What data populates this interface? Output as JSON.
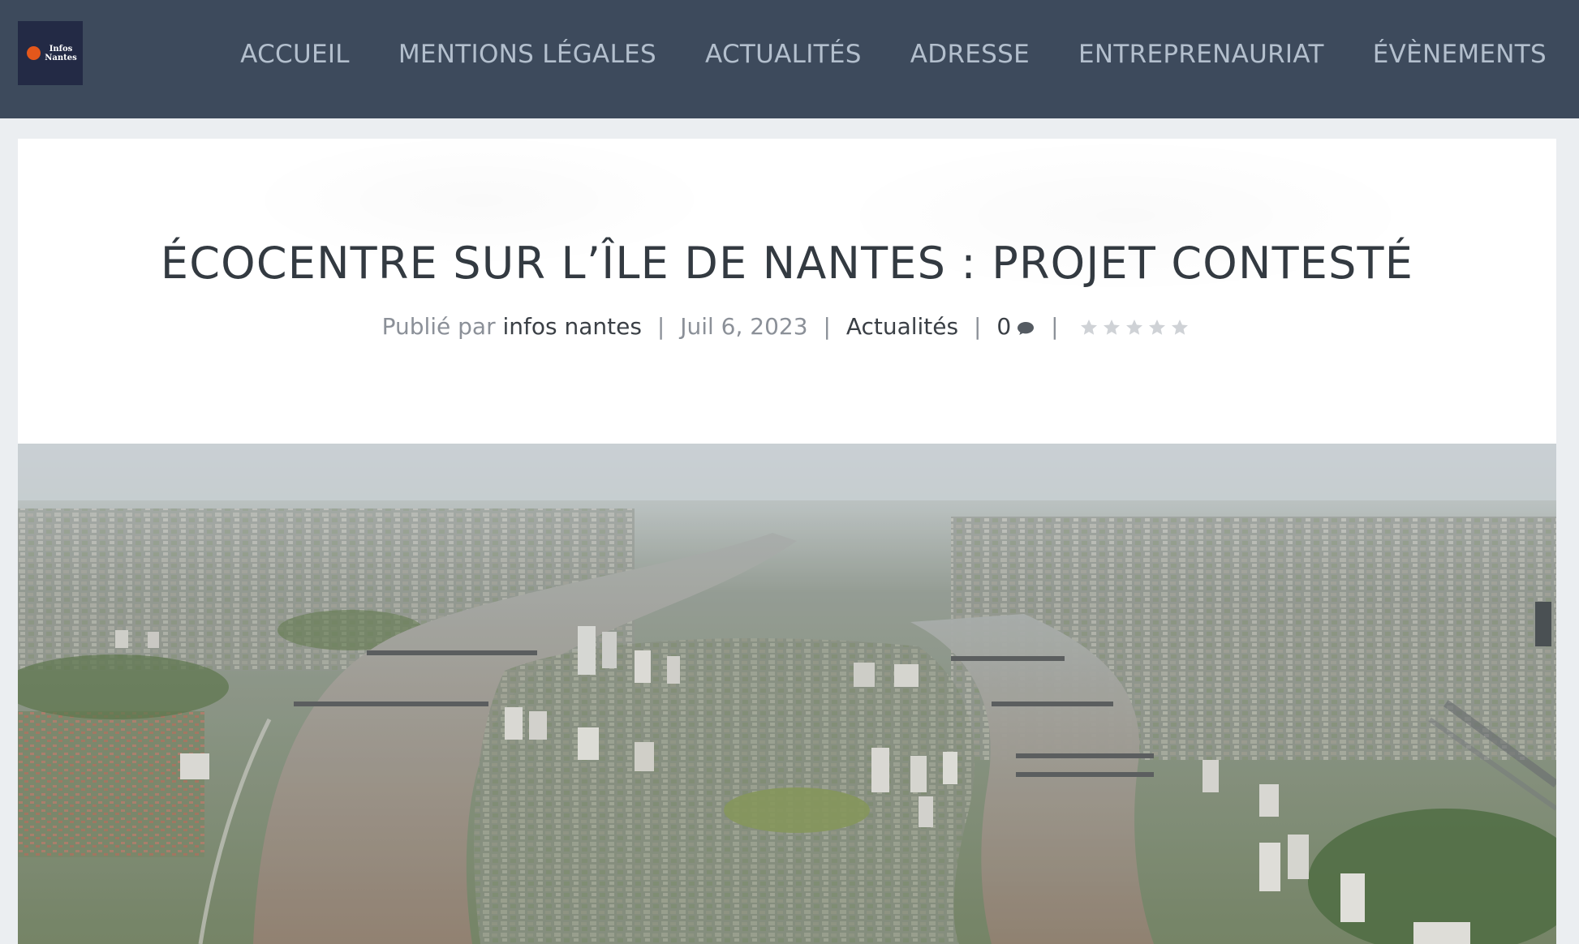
{
  "header": {
    "logo": {
      "line1": "Infos",
      "line2": "Nantes"
    },
    "nav": [
      {
        "label": "ACCUEIL"
      },
      {
        "label": "MENTIONS LÉGALES"
      },
      {
        "label": "ACTUALITÉS"
      },
      {
        "label": "ADRESSE"
      },
      {
        "label": "ENTREPRENAURIAT"
      },
      {
        "label": "ÉVÈNEMENTS"
      }
    ]
  },
  "article": {
    "title": "ÉCOCENTRE SUR L’ÎLE DE NANTES : PROJET CONTESTÉ",
    "meta": {
      "published_by_prefix": "Publié par",
      "author": "infos nantes",
      "date": "Juil 6, 2023",
      "category": "Actualités",
      "comment_count": "0",
      "separator": "|",
      "rating": {
        "stars_filled": 0,
        "stars_total": 5
      }
    }
  },
  "colors": {
    "header_bg": "#3d4a5c",
    "nav_text": "#b3bfcd",
    "logo_bg": "#232a45",
    "logo_accent": "#e4571b",
    "page_bg": "#ebeef1",
    "title_text": "#333a41",
    "meta_text": "#8b9098",
    "meta_link": "#3a3f45",
    "star": "#cfd2d6"
  },
  "icons": {
    "comment": "speech-bubble-icon",
    "rating": "star-icon"
  }
}
